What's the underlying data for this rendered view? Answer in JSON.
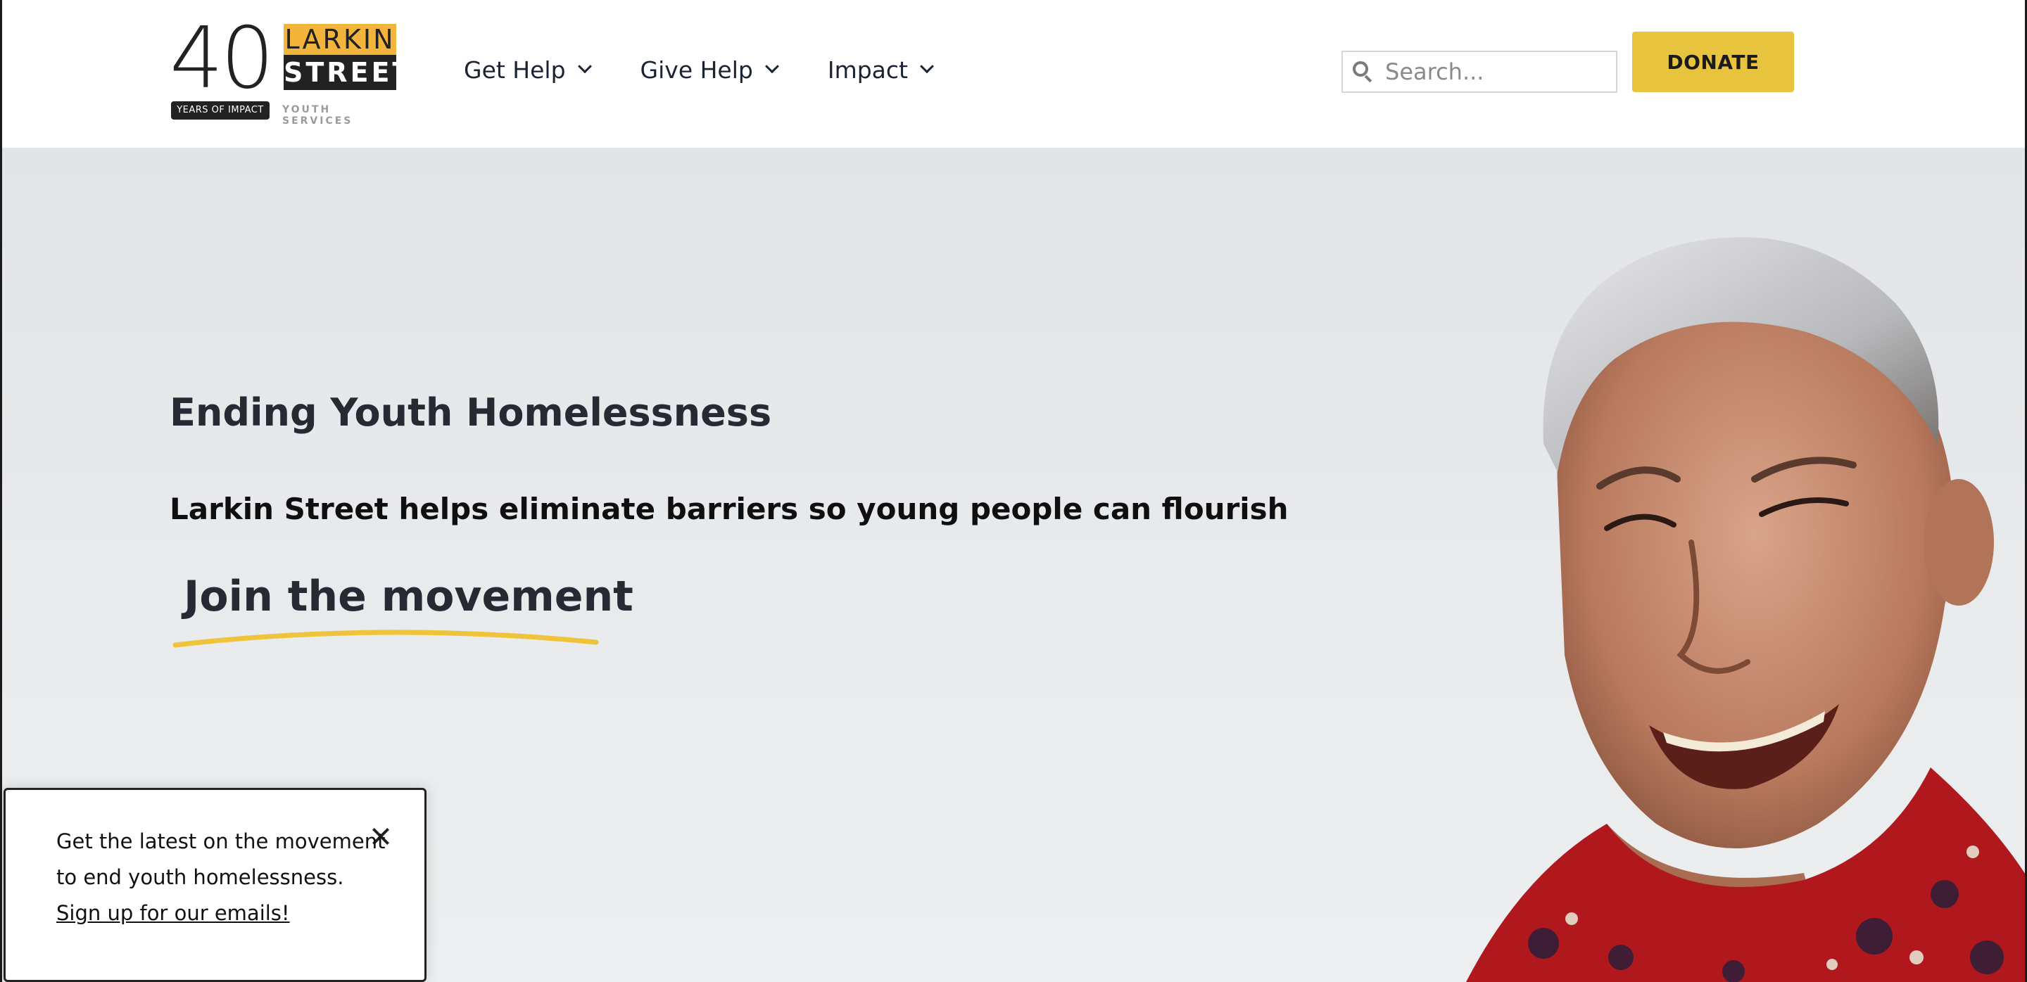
{
  "header": {
    "logo": {
      "number": "40",
      "years_badge": "YEARS OF IMPACT",
      "line1": "LARKIN",
      "line2": "STREET",
      "tagline": "YOUTH SERVICES"
    },
    "nav": [
      {
        "label": "Get Help"
      },
      {
        "label": "Give Help"
      },
      {
        "label": "Impact"
      }
    ],
    "search": {
      "placeholder": "Search...",
      "value": ""
    },
    "donate_label": "DONATE"
  },
  "hero": {
    "title": "Ending Youth Homelessness",
    "subtitle": "Larkin Street helps eliminate barriers so young people can flourish",
    "cta": "Join the movement"
  },
  "popup": {
    "text": "Get the latest on the movement to end youth homelessness.",
    "link": "Sign up for our emails!"
  },
  "colors": {
    "brand_yellow": "#e8c33e",
    "logo_orange": "#f2b43a",
    "text_dark": "#252a33"
  }
}
